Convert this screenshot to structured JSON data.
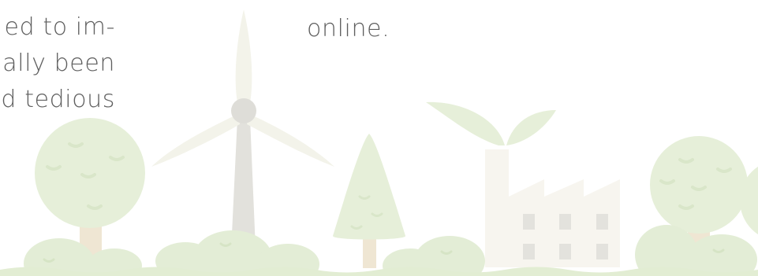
{
  "text": {
    "left_column": [
      "ed to im-",
      "nally been",
      "d  tedious"
    ],
    "right_column": [
      "online."
    ]
  },
  "colors": {
    "tree_green": "#e6efd9",
    "tree_green_dark": "#dce8ce",
    "trunk": "#efe6d3",
    "wind_turbine_blade": "#f3f3ea",
    "wind_turbine_tower": "#e2e1dc",
    "factory": "#f7f5ef",
    "factory_window": "#e3e2dd",
    "ground": "#e2edd3",
    "text": "#5f5f5f"
  }
}
